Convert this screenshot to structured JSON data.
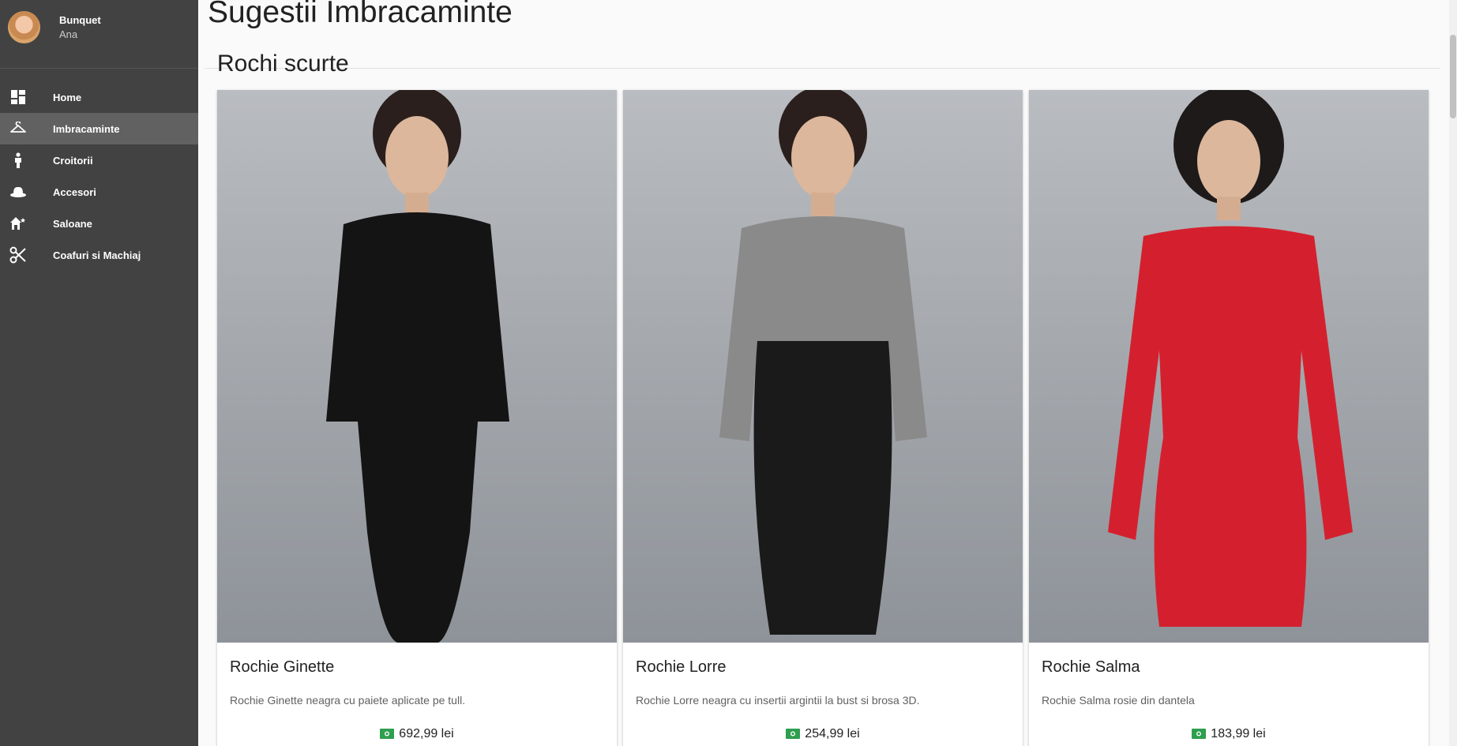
{
  "profile": {
    "first_name": "Bunquet",
    "last_name": "Ana"
  },
  "nav": [
    {
      "label": "Home",
      "icon": "dashboard-icon",
      "active": false
    },
    {
      "label": "Imbracaminte",
      "icon": "hanger-icon",
      "active": true
    },
    {
      "label": "Croitorii",
      "icon": "person-icon",
      "active": false
    },
    {
      "label": "Accesori",
      "icon": "hat-icon",
      "active": false
    },
    {
      "label": "Saloane",
      "icon": "house-icon",
      "active": false
    },
    {
      "label": "Coafuri si Machiaj",
      "icon": "scissors-icon",
      "active": false
    }
  ],
  "main": {
    "title": "Sugestii Imbracaminte",
    "section_title": "Rochi scurte",
    "cards": [
      {
        "title": "Rochie Ginette",
        "description": "Rochie Ginette neagra cu paiete aplicate pe tull.",
        "price": "692,99 lei",
        "dress_color": "#141414"
      },
      {
        "title": "Rochie Lorre",
        "description": "Rochie Lorre neagra cu insertii argintii la bust si brosa 3D.",
        "price": "254,99 lei",
        "dress_color": "#1a1a1a"
      },
      {
        "title": "Rochie Salma",
        "description": "Rochie Salma rosie din dantela",
        "price": "183,99 lei",
        "dress_color": "#d4202e"
      }
    ]
  },
  "colors": {
    "sidebar": "#424242",
    "active_item": "#616161",
    "price_icon": "#2e9e4f"
  }
}
